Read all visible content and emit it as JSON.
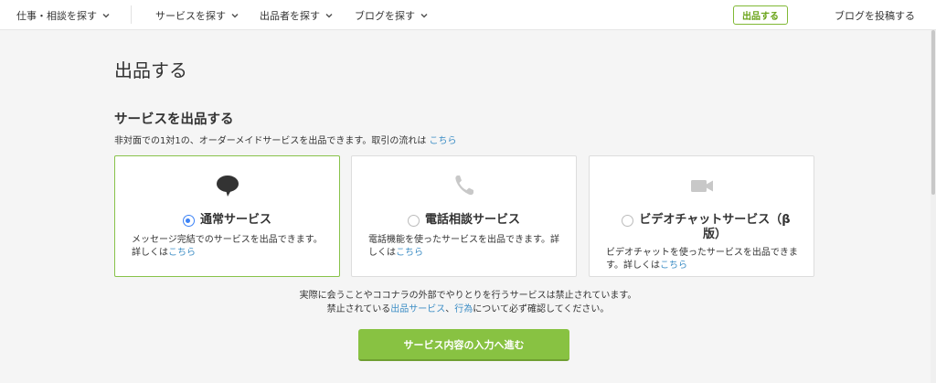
{
  "nav": {
    "items": [
      {
        "label": "仕事・相談を探す"
      },
      {
        "label": "サービスを探す"
      },
      {
        "label": "出品者を探す"
      },
      {
        "label": "ブログを探す"
      }
    ],
    "sell_button": "出品する",
    "post_blog": "ブログを投稿する"
  },
  "page": {
    "title": "出品する"
  },
  "section": {
    "title": "サービスを出品する",
    "desc_prefix": "非対面での1対1の、オーダーメイドサービスを出品できます。取引の流れは ",
    "desc_link": "こちら"
  },
  "cards": [
    {
      "icon": "chat-bubble-icon",
      "title": "通常サービス",
      "desc": "メッセージ完結でのサービスを出品できます。詳しくは",
      "link": "こちら",
      "selected": true
    },
    {
      "icon": "phone-icon",
      "title": "電話相談サービス",
      "desc": "電話機能を使ったサービスを出品できます。詳しくは",
      "link": "こちら",
      "selected": false
    },
    {
      "icon": "video-camera-icon",
      "title_line1": "ビデオチャットサービス（β",
      "title_line2": "版）",
      "desc": "ビデオチャットを使ったサービスを出品できます。詳しくは",
      "link": "こちら",
      "selected": false
    }
  ],
  "notice": {
    "line1": "実際に会うことやココナラの外部でやりとりを行うサービスは禁止されています。",
    "line2_prefix": "禁止されている",
    "link1": "出品サービス",
    "sep": "、",
    "link2": "行為",
    "line2_suffix": "について必ず確認してください。"
  },
  "cta": {
    "label": "サービス内容の入力へ進む"
  },
  "colors": {
    "accent_green": "#88c242",
    "link_blue": "#3c8dc5",
    "radio_blue": "#3b82f6"
  }
}
